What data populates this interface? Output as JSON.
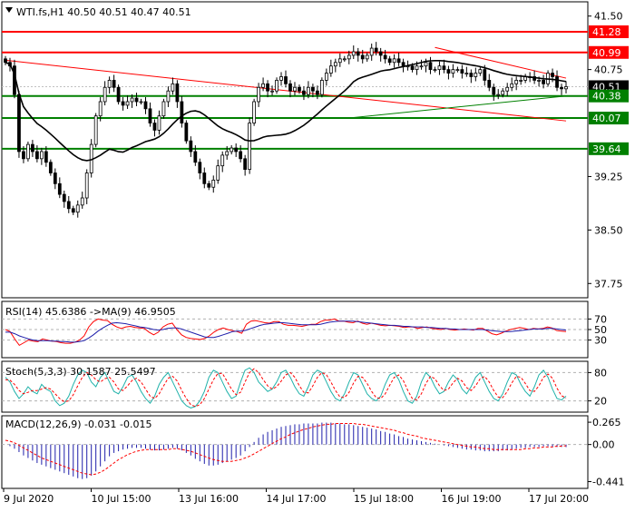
{
  "colors": {
    "up": "#000000",
    "down": "#000000",
    "resistance": "#ff0000",
    "support": "#008000",
    "ma": "#000000",
    "rsi": "#ff0000",
    "rsi_ma": "#1e1eaa",
    "stoch_main": "#20b2aa",
    "stoch_signal": "#ff0000",
    "macd_hist": "#1e1eaa",
    "macd_signal": "#ff0000",
    "price_label_bg": "#000000"
  },
  "header": {
    "title": "WTI.fs,H1  40.50 40.51 40.47 40.51"
  },
  "chart_data": [
    {
      "type": "candlestick",
      "title": "WTI.fs,H1  40.50 40.51 40.47 40.51",
      "symbol": "WTI.fs",
      "timeframe": "H1",
      "last_ohlc": {
        "open": 40.5,
        "high": 40.51,
        "low": 40.47,
        "close": 40.51
      },
      "ylim": [
        37.55,
        41.7
      ],
      "y_ticks": [
        41.5,
        40.75,
        39.25,
        38.5,
        37.75
      ],
      "x_ticks": [
        "9 Jul 2020",
        "10 Jul 15:00",
        "13 Jul 16:00",
        "14 Jul 17:00",
        "15 Jul 18:00",
        "16 Jul 19:00",
        "17 Jul 20:00"
      ],
      "levels": [
        {
          "value": 41.28,
          "label": "41.28",
          "type": "resistance"
        },
        {
          "value": 40.99,
          "label": "40.99",
          "type": "resistance"
        },
        {
          "value": 40.51,
          "label": "40.51",
          "type": "current"
        },
        {
          "value": 40.38,
          "label": "40.38",
          "type": "support"
        },
        {
          "value": 40.07,
          "label": "40.07",
          "type": "support"
        },
        {
          "value": 39.64,
          "label": "39.64",
          "type": "support"
        }
      ],
      "trendlines": [
        {
          "from": [
            0,
            40.88
          ],
          "to": [
            124,
            40.03
          ],
          "type": "resistance"
        },
        {
          "from": [
            95,
            41.06
          ],
          "to": [
            124,
            40.63
          ],
          "type": "resistance"
        },
        {
          "from": [
            76,
            40.07
          ],
          "to": [
            124,
            40.38
          ],
          "type": "support"
        }
      ],
      "close": [
        40.85,
        40.8,
        40.4,
        39.6,
        39.5,
        39.7,
        39.6,
        39.5,
        39.6,
        39.45,
        39.3,
        39.15,
        39.0,
        38.9,
        38.8,
        38.75,
        38.85,
        38.95,
        39.3,
        39.7,
        40.1,
        40.3,
        40.5,
        40.6,
        40.5,
        40.3,
        40.25,
        40.3,
        40.35,
        40.3,
        40.3,
        40.2,
        40.0,
        39.9,
        40.1,
        40.3,
        40.45,
        40.55,
        40.3,
        40.0,
        39.75,
        39.6,
        39.45,
        39.3,
        39.15,
        39.1,
        39.2,
        39.4,
        39.55,
        39.6,
        39.65,
        39.6,
        39.5,
        39.35,
        40.0,
        40.3,
        40.5,
        40.55,
        40.45,
        40.45,
        40.6,
        40.65,
        40.55,
        40.45,
        40.5,
        40.45,
        40.4,
        40.5,
        40.45,
        40.4,
        40.6,
        40.7,
        40.8,
        40.85,
        40.9,
        40.9,
        40.95,
        41.0,
        40.95,
        40.9,
        40.95,
        41.05,
        41.0,
        40.95,
        40.9,
        40.85,
        40.9,
        40.85,
        40.8,
        40.8,
        40.75,
        40.8,
        40.8,
        40.85,
        40.75,
        40.75,
        40.8,
        40.75,
        40.7,
        40.75,
        40.75,
        40.7,
        40.7,
        40.65,
        40.7,
        40.75,
        40.6,
        40.5,
        40.4,
        40.4,
        40.45,
        40.5,
        40.55,
        40.6,
        40.6,
        40.65,
        40.65,
        40.6,
        40.6,
        40.55,
        40.7,
        40.65,
        40.5,
        40.48,
        40.51
      ],
      "ma_period": 24
    },
    {
      "type": "line",
      "title": "RSI(14) 45.6386  ->MA(9) 46.9505",
      "ylim": [
        0,
        100
      ],
      "levels": [
        70,
        50,
        30
      ],
      "series": [
        {
          "name": "RSI(14)",
          "values": [
            50,
            46,
            32,
            20,
            25,
            30,
            28,
            27,
            32,
            30,
            28,
            27,
            25,
            24,
            24,
            26,
            30,
            38,
            55,
            65,
            70,
            68,
            67,
            60,
            55,
            52,
            55,
            56,
            54,
            53,
            52,
            45,
            40,
            45,
            55,
            60,
            62,
            50,
            40,
            35,
            33,
            32,
            31,
            33,
            38,
            45,
            50,
            53,
            50,
            48,
            46,
            43,
            60,
            66,
            67,
            65,
            63,
            62,
            65,
            65,
            60,
            58,
            58,
            57,
            56,
            58,
            60,
            60,
            65,
            68,
            68,
            70,
            66,
            66,
            64,
            63,
            66,
            62,
            60,
            62,
            60,
            58,
            57,
            58,
            57,
            56,
            54,
            55,
            55,
            52,
            54,
            55,
            52,
            51,
            50,
            52,
            50,
            49,
            50,
            51,
            50,
            49,
            52,
            52,
            47,
            42,
            40,
            43,
            47,
            50,
            52,
            54,
            52,
            50,
            52,
            51,
            52,
            55,
            53,
            48,
            47,
            46
          ]
        },
        {
          "name": "MA(9)",
          "values": [
            45,
            45,
            42,
            38,
            35,
            32,
            30,
            29,
            29,
            29,
            28,
            28,
            27,
            27,
            26,
            26,
            27,
            29,
            34,
            40,
            47,
            53,
            58,
            62,
            63,
            62,
            61,
            59,
            57,
            55,
            54,
            52,
            50,
            49,
            50,
            52,
            53,
            53,
            51,
            48,
            45,
            42,
            39,
            36,
            35,
            35,
            37,
            40,
            43,
            46,
            47,
            47,
            49,
            52,
            55,
            58,
            60,
            61,
            62,
            63,
            63,
            62,
            61,
            60,
            59,
            59,
            59,
            59,
            60,
            62,
            64,
            65,
            66,
            66,
            66,
            66,
            65,
            64,
            63,
            62,
            61,
            60,
            59,
            58,
            58,
            57,
            56,
            56,
            55,
            55,
            55,
            54,
            54,
            53,
            52,
            52,
            51,
            51,
            50,
            50,
            50,
            50,
            50,
            50,
            49,
            48,
            47,
            46,
            46,
            46,
            47,
            48,
            49,
            50,
            51,
            51,
            51,
            52,
            52,
            51,
            50,
            49
          ]
        }
      ]
    },
    {
      "type": "line",
      "title": "Stoch(5,3,3) 30.1587 25.5497",
      "ylim": [
        0,
        100
      ],
      "levels": [
        80,
        20
      ],
      "series": [
        {
          "name": "Stoch main",
          "values": [
            70,
            60,
            40,
            25,
            35,
            50,
            40,
            35,
            55,
            45,
            40,
            20,
            10,
            15,
            30,
            55,
            75,
            85,
            80,
            60,
            50,
            70,
            80,
            60,
            40,
            35,
            50,
            70,
            75,
            60,
            40,
            25,
            15,
            30,
            55,
            70,
            80,
            60,
            40,
            20,
            10,
            5,
            8,
            20,
            40,
            70,
            85,
            80,
            60,
            40,
            25,
            30,
            60,
            85,
            90,
            80,
            60,
            50,
            40,
            45,
            60,
            80,
            85,
            70,
            50,
            35,
            30,
            50,
            75,
            85,
            80,
            60,
            40,
            25,
            20,
            35,
            60,
            80,
            75,
            55,
            35,
            25,
            20,
            30,
            55,
            75,
            80,
            65,
            40,
            20,
            15,
            30,
            60,
            80,
            70,
            50,
            35,
            40,
            60,
            75,
            65,
            45,
            35,
            50,
            70,
            80,
            60,
            40,
            25,
            20,
            35,
            60,
            80,
            75,
            55,
            40,
            30,
            50,
            75,
            85,
            70,
            45,
            25,
            22,
            30
          ]
        },
        {
          "name": "Signal",
          "values": [
            65,
            64,
            55,
            42,
            35,
            38,
            42,
            42,
            45,
            48,
            45,
            35,
            25,
            18,
            20,
            33,
            52,
            70,
            80,
            75,
            65,
            60,
            67,
            70,
            60,
            45,
            42,
            52,
            63,
            68,
            60,
            45,
            30,
            25,
            35,
            52,
            68,
            72,
            62,
            42,
            25,
            12,
            8,
            12,
            25,
            45,
            65,
            78,
            78,
            62,
            45,
            33,
            38,
            60,
            80,
            88,
            80,
            65,
            52,
            45,
            50,
            62,
            75,
            80,
            70,
            52,
            38,
            37,
            52,
            70,
            80,
            75,
            60,
            42,
            28,
            27,
            38,
            58,
            72,
            70,
            57,
            40,
            27,
            25,
            35,
            53,
            70,
            75,
            63,
            42,
            25,
            22,
            35,
            57,
            72,
            67,
            52,
            42,
            45,
            58,
            68,
            62,
            48,
            42,
            52,
            67,
            72,
            60,
            42,
            28,
            27,
            40,
            58,
            72,
            70,
            57,
            42,
            40,
            52,
            70,
            77,
            68,
            47,
            31,
            26
          ]
        }
      ]
    },
    {
      "type": "bar",
      "title": "MACD(12,26,9) -0.031 -0.015",
      "ylim": [
        -0.5,
        0.32
      ],
      "y_ticks": [
        0.265,
        0.0,
        -0.441
      ],
      "series": [
        {
          "name": "MACD",
          "values": [
            0.0,
            -0.02,
            -0.05,
            -0.09,
            -0.13,
            -0.16,
            -0.19,
            -0.22,
            -0.24,
            -0.26,
            -0.28,
            -0.3,
            -0.32,
            -0.34,
            -0.36,
            -0.38,
            -0.4,
            -0.41,
            -0.4,
            -0.37,
            -0.32,
            -0.26,
            -0.2,
            -0.14,
            -0.1,
            -0.08,
            -0.06,
            -0.05,
            -0.04,
            -0.04,
            -0.04,
            -0.05,
            -0.06,
            -0.07,
            -0.07,
            -0.06,
            -0.05,
            -0.04,
            -0.05,
            -0.07,
            -0.1,
            -0.13,
            -0.17,
            -0.2,
            -0.23,
            -0.25,
            -0.25,
            -0.24,
            -0.22,
            -0.2,
            -0.18,
            -0.16,
            -0.13,
            -0.08,
            -0.03,
            0.03,
            0.08,
            0.12,
            0.15,
            0.17,
            0.19,
            0.21,
            0.22,
            0.23,
            0.24,
            0.24,
            0.25,
            0.25,
            0.25,
            0.25,
            0.26,
            0.26,
            0.26,
            0.25,
            0.25,
            0.24,
            0.24,
            0.23,
            0.22,
            0.21,
            0.2,
            0.19,
            0.18,
            0.16,
            0.15,
            0.13,
            0.12,
            0.1,
            0.09,
            0.07,
            0.06,
            0.05,
            0.04,
            0.03,
            0.02,
            0.01,
            0.0,
            -0.01,
            -0.02,
            -0.03,
            -0.04,
            -0.05,
            -0.06,
            -0.06,
            -0.07,
            -0.07,
            -0.08,
            -0.08,
            -0.08,
            -0.08,
            -0.07,
            -0.07,
            -0.06,
            -0.05,
            -0.04,
            -0.04,
            -0.03,
            -0.03,
            -0.03,
            -0.02,
            -0.02,
            -0.03,
            -0.03,
            -0.03,
            -0.031
          ]
        },
        {
          "name": "Signal",
          "values": [
            0.05,
            0.04,
            0.02,
            -0.01,
            -0.04,
            -0.07,
            -0.1,
            -0.13,
            -0.16,
            -0.18,
            -0.2,
            -0.22,
            -0.24,
            -0.26,
            -0.28,
            -0.3,
            -0.32,
            -0.34,
            -0.35,
            -0.36,
            -0.35,
            -0.33,
            -0.3,
            -0.26,
            -0.22,
            -0.18,
            -0.15,
            -0.12,
            -0.1,
            -0.08,
            -0.07,
            -0.06,
            -0.06,
            -0.06,
            -0.06,
            -0.06,
            -0.06,
            -0.05,
            -0.05,
            -0.06,
            -0.07,
            -0.08,
            -0.1,
            -0.12,
            -0.14,
            -0.16,
            -0.18,
            -0.19,
            -0.2,
            -0.2,
            -0.2,
            -0.19,
            -0.18,
            -0.16,
            -0.14,
            -0.11,
            -0.08,
            -0.05,
            -0.02,
            0.01,
            0.04,
            0.07,
            0.09,
            0.12,
            0.14,
            0.16,
            0.18,
            0.19,
            0.21,
            0.22,
            0.23,
            0.24,
            0.24,
            0.25,
            0.25,
            0.25,
            0.25,
            0.25,
            0.24,
            0.24,
            0.23,
            0.22,
            0.21,
            0.2,
            0.19,
            0.18,
            0.17,
            0.15,
            0.14,
            0.12,
            0.11,
            0.1,
            0.08,
            0.07,
            0.06,
            0.05,
            0.04,
            0.03,
            0.02,
            0.01,
            0.0,
            -0.01,
            -0.02,
            -0.03,
            -0.03,
            -0.04,
            -0.05,
            -0.05,
            -0.06,
            -0.06,
            -0.06,
            -0.06,
            -0.06,
            -0.06,
            -0.06,
            -0.05,
            -0.05,
            -0.04,
            -0.04,
            -0.03,
            -0.03,
            -0.03,
            -0.02,
            -0.02,
            -0.015
          ]
        }
      ]
    }
  ]
}
